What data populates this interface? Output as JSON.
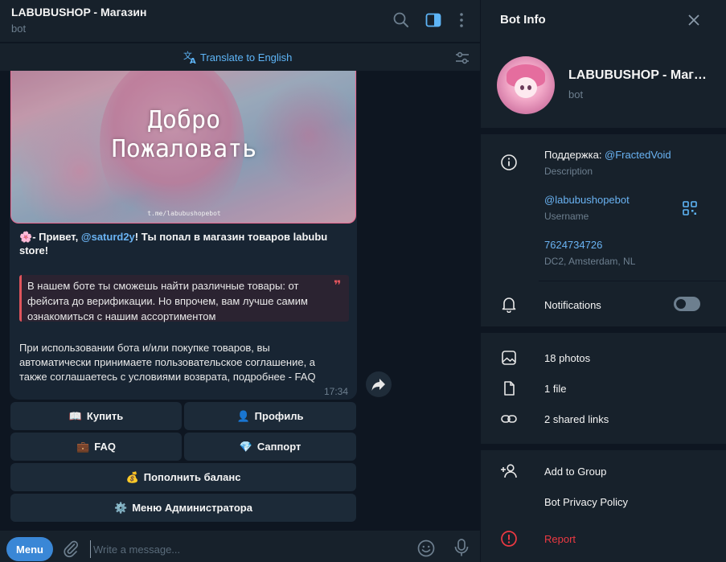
{
  "chat": {
    "title": "LABUBUSHOP - Магазин",
    "subtitle": "bot",
    "translate_label": "Translate to English",
    "image": {
      "line1": "Добро",
      "line2": "Пожаловать",
      "link": "t.me/labubushopebot"
    },
    "greeting_prefix": "- Привет, ",
    "greeting_mention": "@saturd2y",
    "greeting_suffix": "! Ты попал в магазин товаров labubu store!",
    "greeting_emoji": "🌸",
    "quote": "В нашем боте ты сможешь найти различные товары: от фейсита до верификации. Но впрочем, вам лучше самим ознакомиться с нашим ассортиментом",
    "quote_mark": "❞",
    "terms": "При использовании бота и/или покупке товаров, вы автоматически принимаете пользовательское соглашение, а также соглашаетесь с условиями возврата, подробнее - FAQ",
    "time": "17:34",
    "keyboard": {
      "buy": {
        "emoji": "📖",
        "label": "Купить"
      },
      "profile": {
        "emoji": "👤",
        "label": "Профиль"
      },
      "faq": {
        "emoji": "💼",
        "label": "FAQ"
      },
      "support": {
        "emoji": "💎",
        "label": "Саппорт"
      },
      "topup": {
        "emoji": "💰",
        "label": "Пополнить баланс"
      },
      "admin": {
        "emoji": "⚙️",
        "label": "Меню Администратора"
      }
    },
    "composer": {
      "menu_label": "Menu",
      "placeholder": "Write a message..."
    }
  },
  "info": {
    "title": "Bot Info",
    "bot_name": "LABUBUSHOP - Магазин",
    "bot_type": "bot",
    "description_prefix": "Поддержка: ",
    "description_link": "@FractedVoid",
    "description_label": "Description",
    "username": "@labubushopebot",
    "username_label": "Username",
    "id": "7624734726",
    "id_label": "DC2, Amsterdam, NL",
    "notifications_label": "Notifications",
    "notifications_on": false,
    "photos": "18 photos",
    "files": "1 file",
    "links": "2 shared links",
    "add_to_group": "Add to Group",
    "privacy": "Bot Privacy Policy",
    "report": "Report"
  },
  "colors": {
    "accent": "#5eb5f7",
    "link": "#6ab3f3",
    "danger": "#ec3942",
    "panel": "#17212b",
    "background": "#0e1621"
  },
  "icons": [
    "search-icon",
    "sidebar-toggle-icon",
    "more-icon",
    "translate-icon",
    "settings-icon",
    "forward-icon",
    "attach-icon",
    "emoji-icon",
    "mic-icon",
    "close-icon",
    "info-icon",
    "qr-code-icon",
    "bell-icon",
    "photo-icon",
    "file-icon",
    "link-icon",
    "add-user-icon",
    "alert-icon"
  ]
}
